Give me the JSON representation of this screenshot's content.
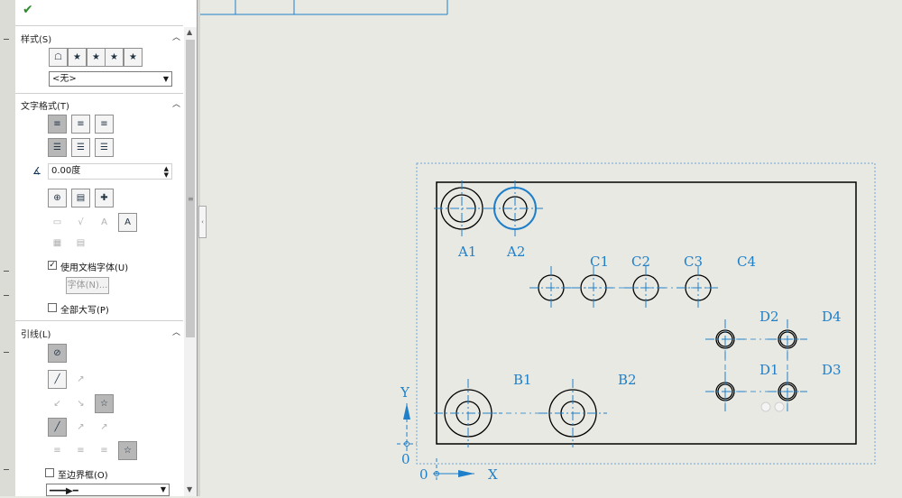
{
  "panel": {
    "ok_icon": "checkmark-icon",
    "style_section": {
      "title": "样式(S)",
      "buttons": [
        "style-apply-icon",
        "add-style-icon",
        "delete-style-icon",
        "save-style-icon",
        "load-style-icon"
      ],
      "dropdown_value": "<无>"
    },
    "text_format_section": {
      "title": "文字格式(T)",
      "align_buttons": [
        "align-left-icon",
        "align-center-icon",
        "align-right-icon"
      ],
      "valign_buttons": [
        "align-top-icon",
        "align-middle-icon",
        "align-bottom-icon"
      ],
      "angle_value": "0.00度",
      "insert_buttons": [
        "insert-hyperlink-icon",
        "link-property-icon",
        "add-symbol-icon"
      ],
      "use_doc_font_label": "使用文档字体(U)",
      "use_doc_font_checked": true,
      "font_button": "字体(N)...",
      "all_caps_label": "全部大写(P)",
      "all_caps_checked": false
    },
    "leader_section": {
      "title": "引线(L)",
      "to_border_label": "至边界框(O)",
      "to_border_checked": false
    }
  },
  "drawing": {
    "labels": {
      "A1": "A1",
      "A2": "A2",
      "B1": "B1",
      "B2": "B2",
      "C1": "C1",
      "C2": "C2",
      "C3": "C3",
      "C4": "C4",
      "D1": "D1",
      "D2": "D2",
      "D3": "D3",
      "D4": "D4",
      "origin_y": "0",
      "origin_x": "0",
      "axis_x": "X",
      "axis_y": "Y"
    },
    "colors": {
      "background": "#e9e9e3",
      "sketch_blue": "#1f7fc8",
      "outline": "#000000",
      "selection_dashes": "#6fa7d9"
    }
  }
}
